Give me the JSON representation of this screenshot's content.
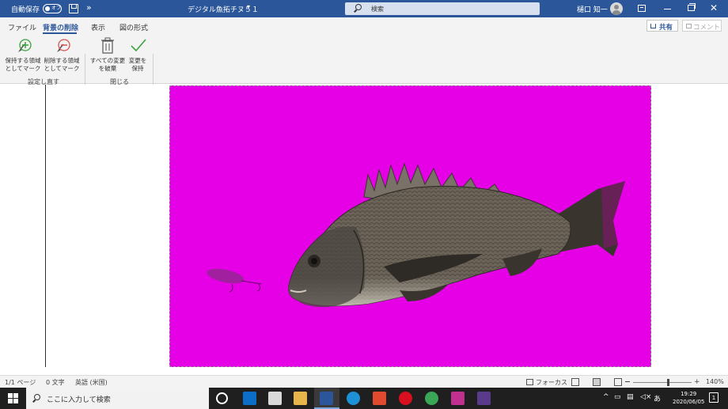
{
  "titlebar": {
    "autosave_label": "自動保存",
    "autosave_state": "オフ",
    "document_title": "デジタル魚拓チヌ５１",
    "search_placeholder": "検索",
    "user_name": "樋口 知一"
  },
  "ribbon": {
    "tabs": [
      {
        "label": "ファイル"
      },
      {
        "label": "背景の削除"
      },
      {
        "label": "表示"
      },
      {
        "label": "図の形式"
      }
    ],
    "share_label": "共有",
    "comment_label": "コメント",
    "groups": {
      "refine": {
        "label": "設定し直す",
        "mark_keep": {
          "line1": "保持する領域",
          "line2": "としてマーク"
        },
        "mark_remove": {
          "line1": "削除する領域",
          "line2": "としてマーク"
        }
      },
      "close": {
        "label": "閉じる",
        "discard": {
          "line1": "すべての変更",
          "line2": "を破棄"
        },
        "keep": {
          "line1": "変更を",
          "line2": "保持"
        }
      }
    }
  },
  "statusbar": {
    "page": "1/1 ページ",
    "words": "0 文字",
    "language": "英語 (米国)",
    "focus": "フォーカス",
    "zoom": "140%"
  },
  "taskbar": {
    "search_placeholder": "ここに入力して検索",
    "ime": "あ",
    "time": "19:29",
    "date": "2020/06/05",
    "notifications": "1"
  },
  "colors": {
    "title_blue": "#2b579a",
    "removal_magenta": "#e600e6"
  }
}
